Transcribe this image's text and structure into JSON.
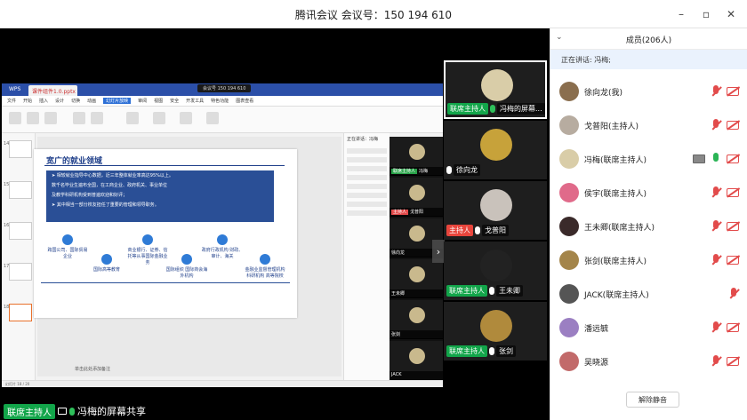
{
  "window": {
    "title": "腾讯会议 会议号：150 194 610",
    "minimize": "–",
    "restore": "▫",
    "close": "✕"
  },
  "shared_screen": {
    "app_label": "WPS",
    "file_tab": "课件组件1.0.pptx",
    "meeting_tag": "会议号 150 194 610",
    "menu": [
      "文件",
      "开始",
      "插入",
      "设计",
      "切换",
      "动画",
      "幻灯片放映",
      "审阅",
      "视图",
      "安全",
      "开发工具",
      "特色功能",
      "图表查看"
    ],
    "active_menu_index": 6,
    "slide": {
      "title": "宽广的就业领域",
      "lines": [
        "➤ 相较就业指导中心数据，近三年整体就业率高达95%以上。",
        "   数千名毕业生遍布全国，在工商企业、政府机关、事业单位",
        "   及教学科研机构受到普遍欢迎和好评；",
        "➤ 其中相当一部分校友担任了重要的管理和领导职务。"
      ],
      "nodes": [
        {
          "label": "跨国公司、国际贸易企业"
        },
        {
          "label": "国际高等教育"
        },
        {
          "label": "商业银行、证券、信托等从事国际金融业务"
        },
        {
          "label": "国际组织 国际商会海外机构"
        },
        {
          "label": "政府行政机构 财政、审计、海关"
        },
        {
          "label": "金融业监督管理机构 科研机构 高等院校"
        }
      ]
    },
    "thumb_numbers": [
      "14",
      "15",
      "16",
      "17",
      "18"
    ],
    "right_panel_head": "正在讲话：冯梅",
    "hint": "单击此处添加备注",
    "status": "幻灯片 18 / 20"
  },
  "mini_tiles": [
    {
      "tag": "联席主持人",
      "name": "冯梅"
    },
    {
      "tag": "主持人",
      "name": "戈普阳"
    },
    {
      "tag": "",
      "name": "徐向龙"
    },
    {
      "tag": "",
      "name": "王未卿"
    },
    {
      "tag": "",
      "name": "张剑"
    },
    {
      "tag": "",
      "name": "JACK"
    }
  ],
  "speaker_label": {
    "tag": "联席主持人",
    "text": "冯梅的屏幕共享"
  },
  "video_tiles": [
    {
      "tag": "联席主持人",
      "tag_color": "#12a54a",
      "name": "冯梅的屏幕...",
      "avatar_color": "#d9cda8"
    },
    {
      "tag": "",
      "tag_color": "",
      "name": "徐向龙",
      "avatar_color": "#c7a23a"
    },
    {
      "tag": "主持人",
      "tag_color": "#e8453c",
      "name": "戈普阳",
      "avatar_color": "#c9c2bb"
    },
    {
      "tag": "联席主持人",
      "tag_color": "#12a54a",
      "name": "王未卿",
      "avatar_color": "#222222"
    },
    {
      "tag": "联席主持人",
      "tag_color": "#12a54a",
      "name": "张剑",
      "avatar_color": "#b08a3c"
    }
  ],
  "members": {
    "header": "成员(206人)",
    "speaking": "正在讲话: 冯梅;",
    "unmute_button": "解除静音",
    "list": [
      {
        "name": "徐向龙(我)",
        "avatar_color": "#8a6e4e",
        "mic": "off",
        "cam": "off",
        "sharing": false
      },
      {
        "name": "戈普阳(主持人)",
        "avatar_color": "#b7aca0",
        "mic": "off",
        "cam": "off",
        "sharing": false
      },
      {
        "name": "冯梅(联席主持人)",
        "avatar_color": "#d9cda8",
        "mic": "on",
        "cam": "off",
        "sharing": true
      },
      {
        "name": "侯宇(联席主持人)",
        "avatar_color": "#e06a8a",
        "mic": "off",
        "cam": "off",
        "sharing": false
      },
      {
        "name": "王未卿(联席主持人)",
        "avatar_color": "#3a2a2a",
        "mic": "off",
        "cam": "off",
        "sharing": false
      },
      {
        "name": "张剑(联席主持人)",
        "avatar_color": "#a4854a",
        "mic": "off",
        "cam": "off",
        "sharing": false
      },
      {
        "name": "JACK(联席主持人)",
        "avatar_color": "#555555",
        "mic": "off",
        "cam": "none",
        "sharing": false
      },
      {
        "name": "潘远毓",
        "avatar_color": "#9b7fc2",
        "mic": "off",
        "cam": "off",
        "sharing": false
      },
      {
        "name": "吴晓源",
        "avatar_color": "#c26a6a",
        "mic": "off",
        "cam": "off",
        "sharing": false
      }
    ]
  }
}
